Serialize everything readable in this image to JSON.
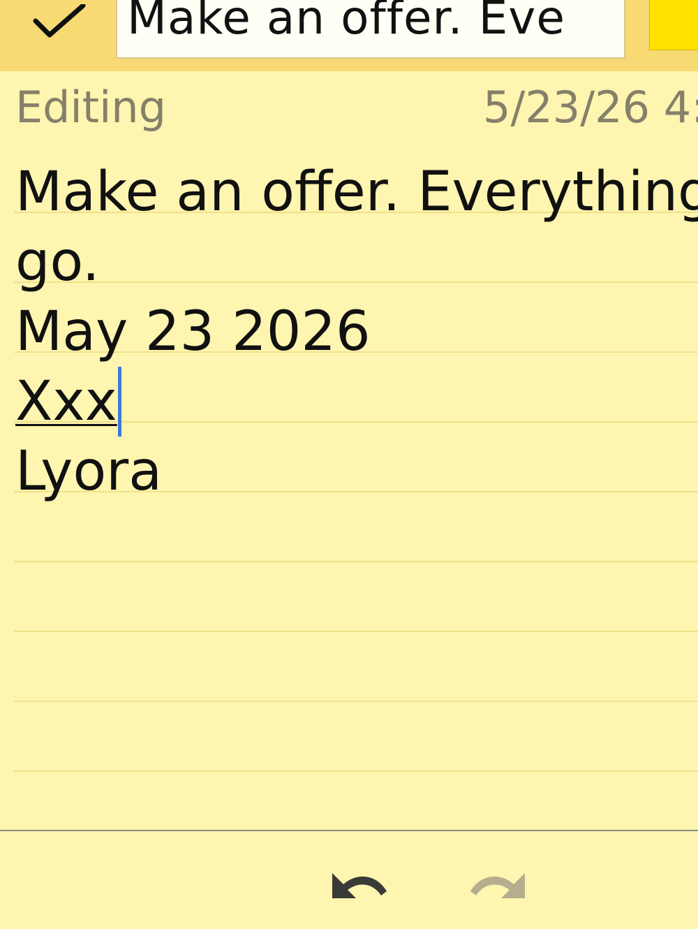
{
  "toolbar": {
    "done_icon": "checkmark-icon",
    "title_value": "Make an offer. Eve",
    "color_swatch": "#ffe200"
  },
  "status": {
    "label": "Editing",
    "timestamp": "5/23/26 4:"
  },
  "note": {
    "lines": [
      "Make an offer. Everything",
      "go.",
      "May 23 2026",
      "Xxx",
      "Lyora"
    ]
  },
  "bottom_toolbar": {
    "undo_icon": "undo-icon",
    "redo_icon": "redo-icon"
  },
  "colors": {
    "paper": "#fdf5b0",
    "header": "#f7da73",
    "rule": "#f0e18a",
    "caret": "#3f78d8",
    "muted_text": "#85806a"
  }
}
